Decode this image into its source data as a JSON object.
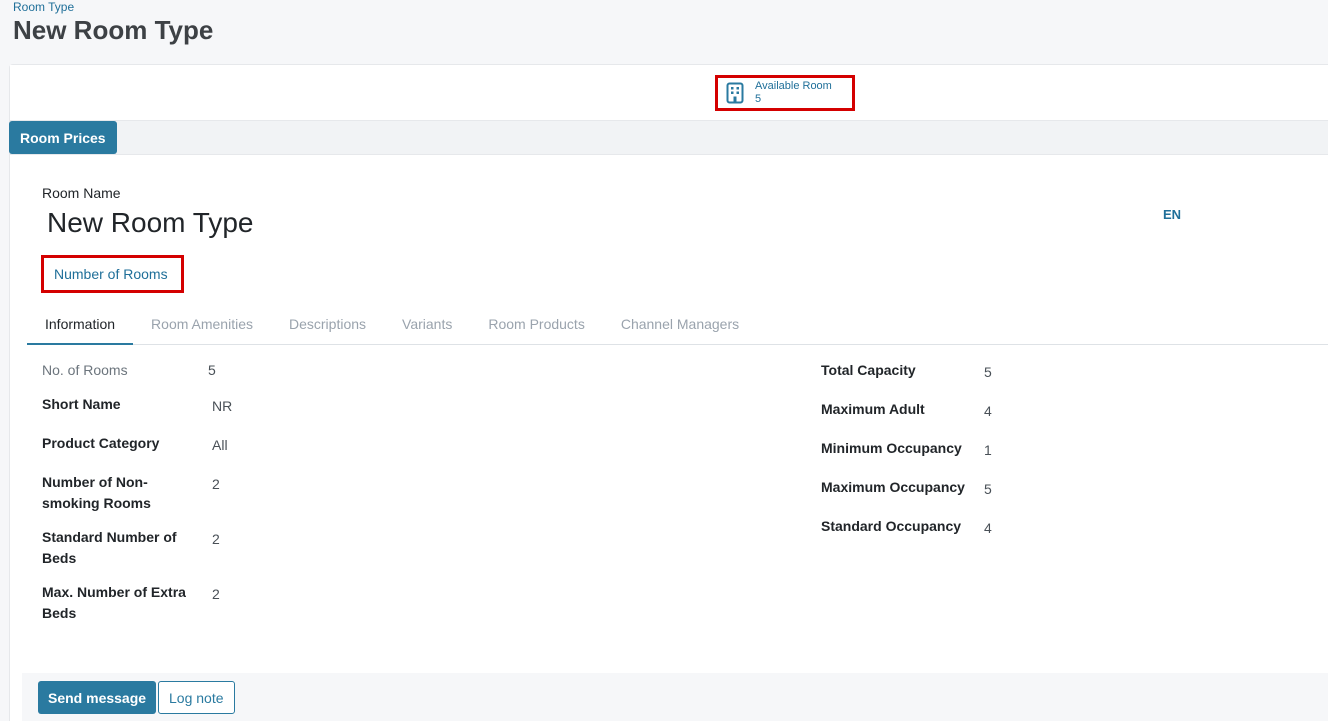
{
  "header": {
    "breadcrumb": "Room Type",
    "title": "New Room Type"
  },
  "smart_button": {
    "label": "Available Room",
    "value": "5",
    "icon": "building-icon"
  },
  "statusbar": {
    "room_prices_label": "Room Prices"
  },
  "form": {
    "room_name_label": "Room Name",
    "room_name_value": "New Room Type",
    "language": "EN",
    "number_of_rooms_link": "Number of Rooms"
  },
  "tabs": [
    {
      "label": "Information",
      "active": true
    },
    {
      "label": "Room Amenities",
      "active": false
    },
    {
      "label": "Descriptions",
      "active": false
    },
    {
      "label": "Variants",
      "active": false
    },
    {
      "label": "Room Products",
      "active": false
    },
    {
      "label": "Channel Managers",
      "active": false
    }
  ],
  "left_fields": [
    {
      "label": "No. of Rooms",
      "value": "5"
    },
    {
      "label": "Short Name",
      "value": "NR"
    },
    {
      "label": "Product Category",
      "value": "All"
    },
    {
      "label": "Number of Non-smoking Rooms",
      "value": "2"
    },
    {
      "label": "Standard Number of Beds",
      "value": "2"
    },
    {
      "label": "Max. Number of Extra Beds",
      "value": "2"
    }
  ],
  "right_fields": [
    {
      "label": "Total Capacity",
      "value": "5"
    },
    {
      "label": "Maximum Adult",
      "value": "4"
    },
    {
      "label": "Minimum Occupancy",
      "value": "1"
    },
    {
      "label": "Maximum Occupancy",
      "value": "5"
    },
    {
      "label": "Standard Occupancy",
      "value": "4"
    }
  ],
  "chatter": {
    "send_message": "Send message",
    "log_note": "Log note"
  },
  "colors": {
    "primary": "#2a7aa0",
    "link": "#1f6f99",
    "highlight_border": "#d40000"
  }
}
